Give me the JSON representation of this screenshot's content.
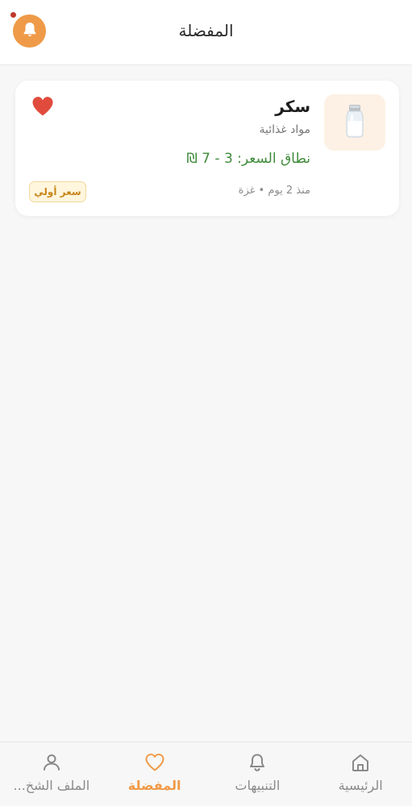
{
  "header": {
    "title": "المفضلة"
  },
  "favorites": [
    {
      "name": "سكر",
      "category": "مواد غذائية",
      "price_range": "نطاق السعر: 3 - 7 ₪",
      "meta": "منذ 2 يوم • غزة",
      "badge": "سعر أولي",
      "thumb_icon": "salt-shaker-icon"
    }
  ],
  "nav": {
    "items": [
      {
        "label": "الرئيسية",
        "icon": "home-icon",
        "active": false
      },
      {
        "label": "التنبيهات",
        "icon": "bell-icon",
        "active": false
      },
      {
        "label": "المفضلة",
        "icon": "heart-icon",
        "active": true
      },
      {
        "label": "الملف الشخ...",
        "icon": "user-icon",
        "active": false
      }
    ]
  },
  "colors": {
    "accent": "#ef9a48",
    "price": "#3f8b3a",
    "heart": "#e04b3c",
    "badge_text": "#c8861a"
  }
}
